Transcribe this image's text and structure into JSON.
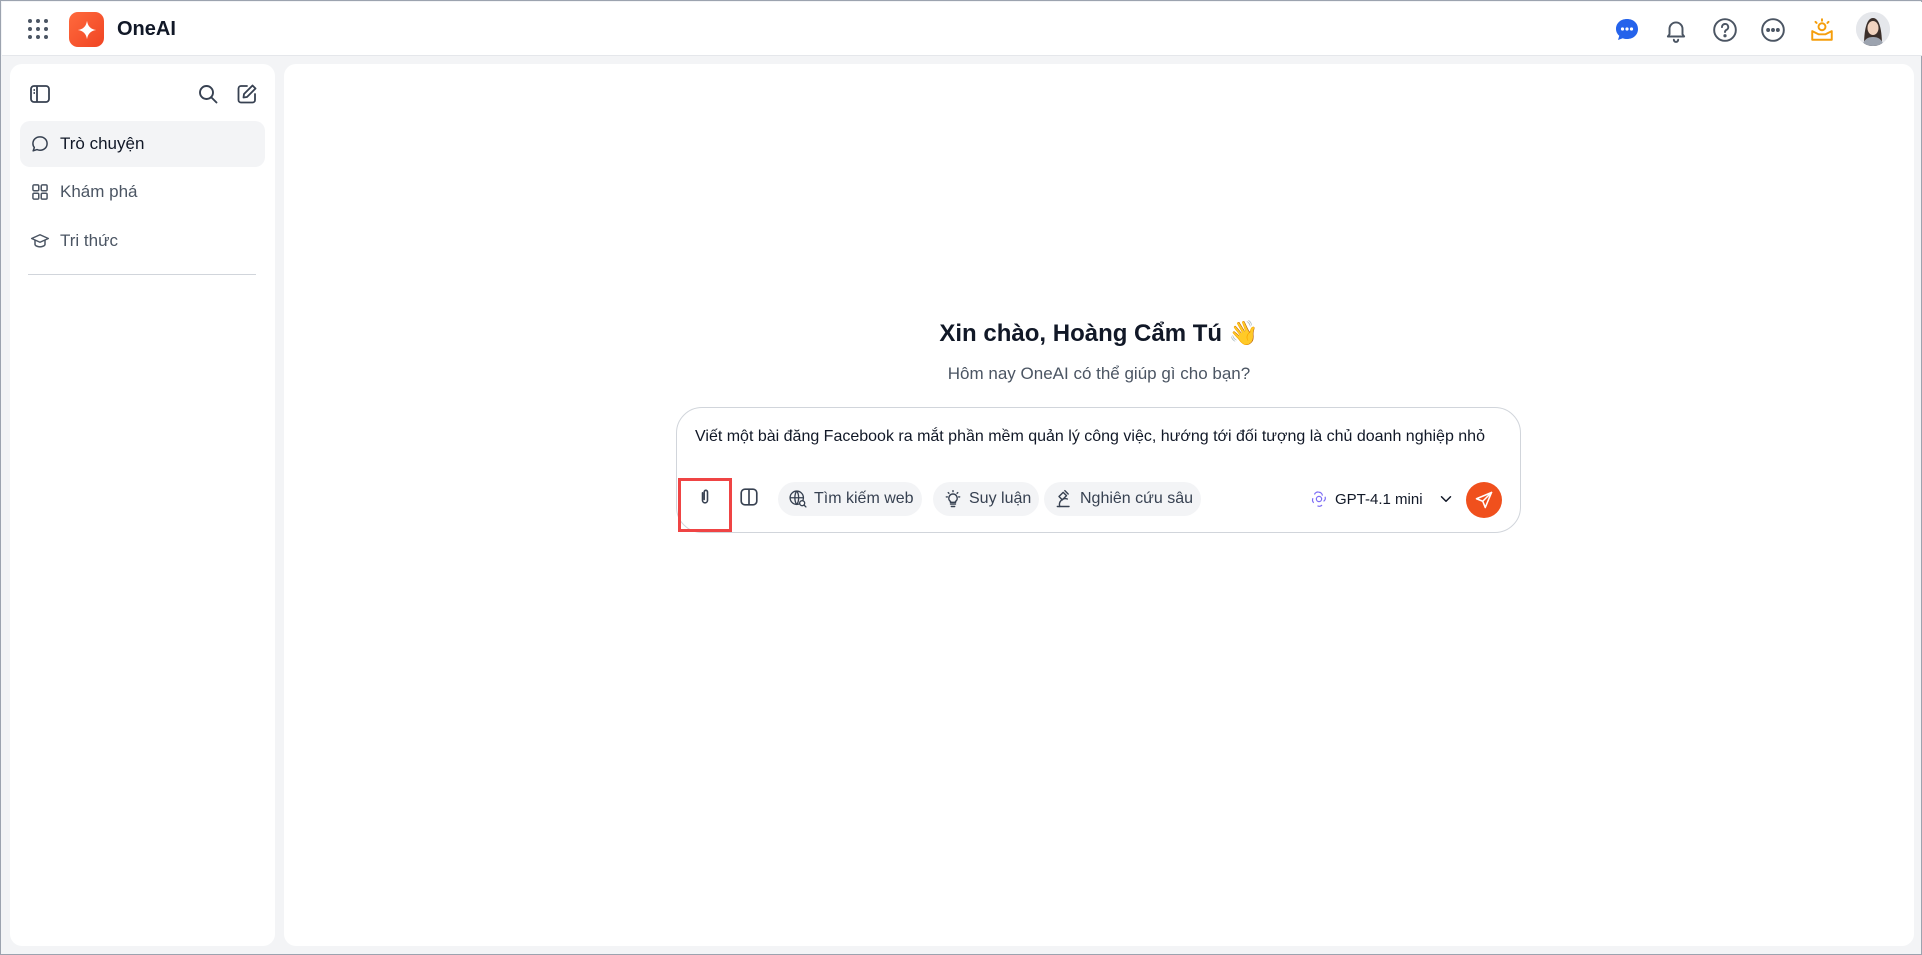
{
  "app": {
    "name": "OneAI",
    "accent": "#f0501d"
  },
  "sidebar": {
    "items": [
      {
        "label": "Trò chuyện",
        "icon": "chat-bubble-icon",
        "active": true
      },
      {
        "label": "Khám phá",
        "icon": "grid-apps-icon",
        "active": false
      },
      {
        "label": "Tri thức",
        "icon": "graduation-cap-icon",
        "active": false
      }
    ]
  },
  "main": {
    "greeting": "Xin chào, Hoàng Cẩm Tú 👋",
    "subtitle": "Hôm nay OneAI có thể giúp gì cho bạn?",
    "prompt": "Viết một bài đăng Facebook ra mắt phần mềm quản lý công việc, hướng tới đối tượng là chủ doanh nghiệp nhỏ",
    "chips": {
      "web": "Tìm kiếm web",
      "reason": "Suy luận",
      "research": "Nghiên cứu sâu"
    },
    "model": "GPT-4.1 mini"
  }
}
